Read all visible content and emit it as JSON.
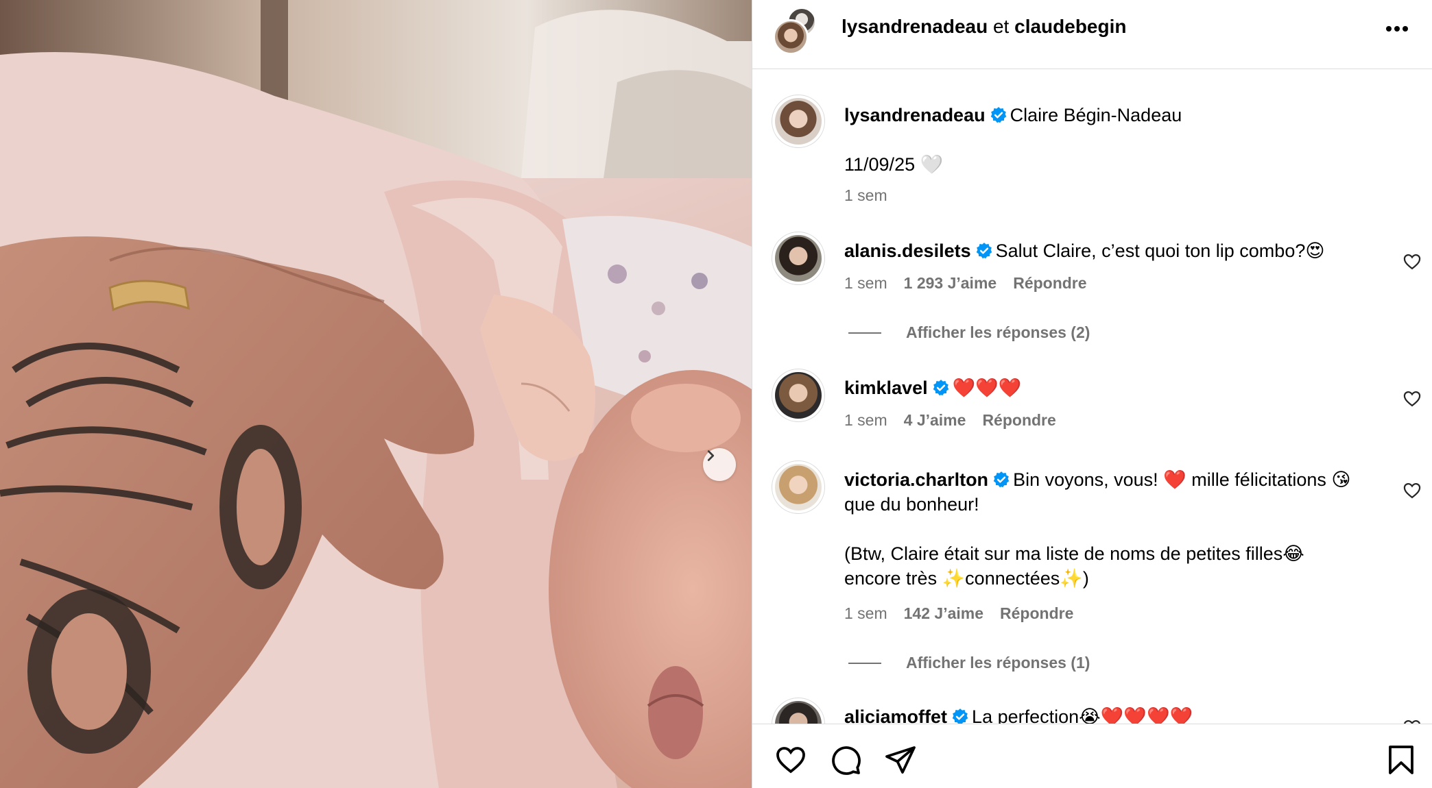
{
  "header": {
    "user1": "lysandrenadeau",
    "joiner": " et ",
    "user2": "claudebegin"
  },
  "post": {
    "author": "lysandrenadeau",
    "caption": "Claire Bégin-Nadeau",
    "caption_line2": "11/09/25 🤍",
    "time": "1 sem"
  },
  "comments": [
    {
      "username": "alanis.desilets",
      "text": "Salut Claire, c’est quoi ton lip combo?😍",
      "time": "1 sem",
      "likes": "1 293 J’aime",
      "reply": "Répondre",
      "view_replies": "Afficher les réponses (2)"
    },
    {
      "username": "kimklavel",
      "text": "❤️❤️❤️",
      "time": "1 sem",
      "likes": "4 J’aime",
      "reply": "Répondre"
    },
    {
      "username": "victoria.charlton",
      "text_line1": "Bin voyons, vous! ❤️ mille félicitations 😘",
      "text_line2": "que du bonheur!",
      "text_line3": "(Btw, Claire était sur ma liste de noms de petites filles😂",
      "text_line4": "encore très ✨connectées✨)",
      "time": "1 sem",
      "likes": "142 J’aime",
      "reply": "Répondre",
      "view_replies": "Afficher les réponses (1)"
    },
    {
      "username": "aliciamoffet",
      "text": "La perfection😭❤️❤️❤️❤️"
    }
  ],
  "colors": {
    "verified": "#0095f6",
    "meta_text": "#737373",
    "divider": "#dbdbdb"
  },
  "icons": [
    "more-icon",
    "verified-icon",
    "heart-icon",
    "comment-icon",
    "share-icon",
    "bookmark-icon",
    "chevron-right-icon"
  ]
}
